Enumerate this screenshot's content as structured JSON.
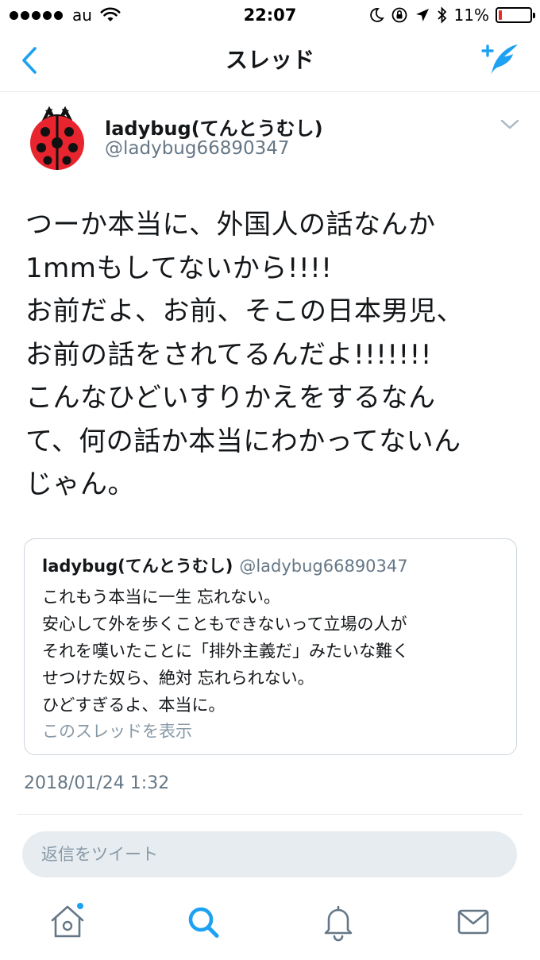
{
  "status_bar": {
    "carrier": "au",
    "time": "22:07",
    "battery_percent": "11%",
    "battery_level": 0.11,
    "battery_color": "#e0322b"
  },
  "nav": {
    "title": "スレッド",
    "back_icon": "chevron-left-icon",
    "compose_icon": "compose-tweet-icon",
    "accent_color": "#1da1f2"
  },
  "tweet": {
    "author_name": "ladybug(てんとうむし)",
    "author_handle": "@ladybug66890347",
    "avatar_icon": "ladybug-avatar",
    "body": "つーか本当に、外国人の話なんか\n1mmもしてないから!!!!\nお前だよ、お前、そこの日本男児、\nお前の話をされてるんだよ!!!!!!!\nこんなひどいすりかえをするなん\nて、何の話か本当にわかってないん\nじゃん。",
    "timestamp": "2018/01/24 1:32",
    "quoted": {
      "author_name": "ladybug(てんとうむし)",
      "author_handle": "@ladybug66890347",
      "text": "これもう本当に一生 忘れない。\n安心して外を歩くこともできないって立場の人が\nそれを嘆いたことに「排外主義だ」みたいな難く\nせつけた奴ら、絶対 忘れられない。\nひどすぎるよ、本当に。",
      "show_thread_label": "このスレッドを表示"
    }
  },
  "reply": {
    "placeholder": "返信をツイート"
  },
  "tab_bar": {
    "tabs": [
      {
        "id": "home",
        "icon": "home-icon",
        "has_badge": true
      },
      {
        "id": "search",
        "icon": "search-icon",
        "active": true
      },
      {
        "id": "notifications",
        "icon": "bell-icon"
      },
      {
        "id": "messages",
        "icon": "envelope-icon"
      }
    ]
  }
}
